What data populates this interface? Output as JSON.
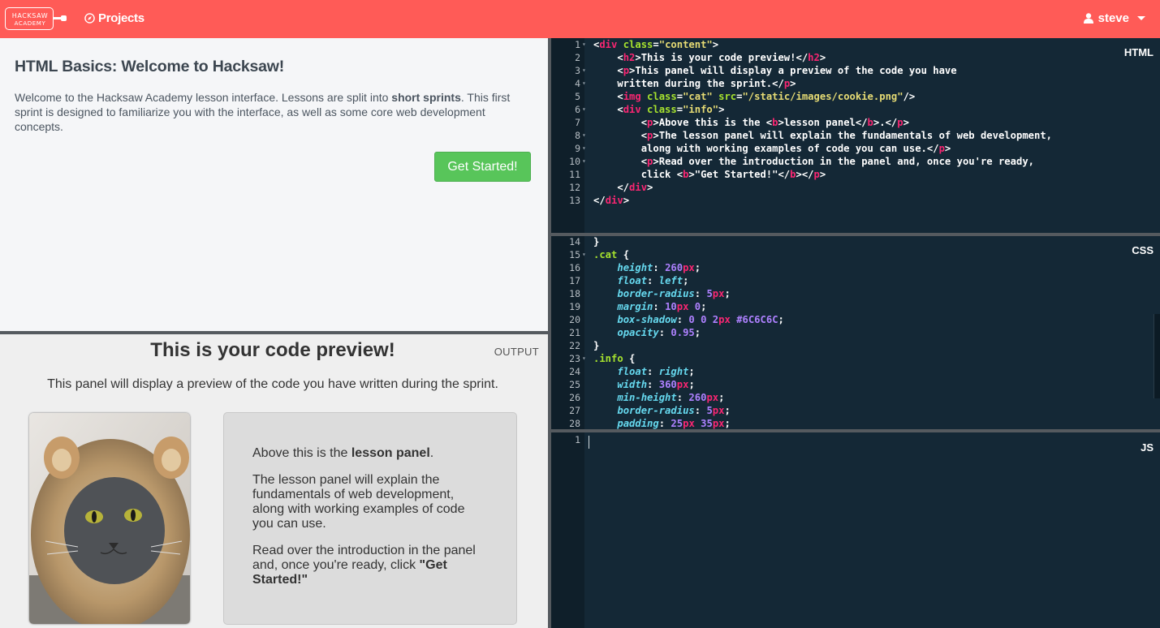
{
  "header": {
    "logo_line1": "HACKSAW",
    "logo_line2": "ACADEMY",
    "projects_label": "Projects",
    "user_name": "steve"
  },
  "lesson": {
    "title": "HTML Basics: Welcome to Hacksaw!",
    "intro_before": "Welcome to the Hacksaw Academy lesson interface. Lessons are split into ",
    "intro_bold": "short sprints",
    "intro_after": ". This first sprint is designed to familiarize you with the interface, as well as some core web development concepts.",
    "start_button": "Get Started!"
  },
  "output": {
    "label": "OUTPUT",
    "heading": "This is your code preview!",
    "paragraph": "This panel will display a preview of the code you have written during the sprint.",
    "info_p1_before": "Above this is the ",
    "info_p1_bold": "lesson panel",
    "info_p1_after": ".",
    "info_p2": "The lesson panel will explain the fundamentals of web development, along with working examples of code you can use.",
    "info_p3_before": "Read over the introduction in the panel and, once you're ready, click ",
    "info_p3_bold": "\"Get Started!\""
  },
  "editors": {
    "html_label": "HTML",
    "css_label": "CSS",
    "js_label": "JS"
  },
  "html_code": [
    {
      "n": "1",
      "fold": true,
      "segs": [
        [
          "p",
          "<"
        ],
        [
          "tag",
          "div"
        ],
        [
          "p",
          " "
        ],
        [
          "attr",
          "class"
        ],
        [
          "p",
          "="
        ],
        [
          "str",
          "\"content\""
        ],
        [
          "p",
          ">"
        ]
      ]
    },
    {
      "n": "2",
      "fold": false,
      "segs": [
        [
          "p",
          "    <"
        ],
        [
          "tag",
          "h2"
        ],
        [
          "p",
          ">This is your code preview!</"
        ],
        [
          "tag",
          "h2"
        ],
        [
          "p",
          ">"
        ]
      ]
    },
    {
      "n": "3",
      "fold": true,
      "segs": [
        [
          "p",
          "    <"
        ],
        [
          "tag",
          "p"
        ],
        [
          "p",
          ">This panel will display a preview of the code you have"
        ]
      ]
    },
    {
      "n": "4",
      "fold": true,
      "segs": [
        [
          "p",
          "    written during the sprint.</"
        ],
        [
          "tag",
          "p"
        ],
        [
          "p",
          ">"
        ]
      ]
    },
    {
      "n": "5",
      "fold": false,
      "segs": [
        [
          "p",
          "    <"
        ],
        [
          "tag",
          "img"
        ],
        [
          "p",
          " "
        ],
        [
          "attr",
          "class"
        ],
        [
          "p",
          "="
        ],
        [
          "str",
          "\"cat\""
        ],
        [
          "p",
          " "
        ],
        [
          "attr",
          "src"
        ],
        [
          "p",
          "="
        ],
        [
          "str",
          "\"/static/images/cookie.png\""
        ],
        [
          "p",
          "/>"
        ]
      ]
    },
    {
      "n": "6",
      "fold": true,
      "segs": [
        [
          "p",
          "    <"
        ],
        [
          "tag",
          "div"
        ],
        [
          "p",
          " "
        ],
        [
          "attr",
          "class"
        ],
        [
          "p",
          "="
        ],
        [
          "str",
          "\"info\""
        ],
        [
          "p",
          ">"
        ]
      ]
    },
    {
      "n": "7",
      "fold": false,
      "segs": [
        [
          "p",
          "        <"
        ],
        [
          "tag",
          "p"
        ],
        [
          "p",
          ">Above this is the <"
        ],
        [
          "tag",
          "b"
        ],
        [
          "p",
          ">lesson panel</"
        ],
        [
          "tag",
          "b"
        ],
        [
          "p",
          ">.</"
        ],
        [
          "tag",
          "p"
        ],
        [
          "p",
          ">"
        ]
      ]
    },
    {
      "n": "8",
      "fold": true,
      "segs": [
        [
          "p",
          "        <"
        ],
        [
          "tag",
          "p"
        ],
        [
          "p",
          ">The lesson panel will explain the fundamentals of web development,"
        ]
      ]
    },
    {
      "n": "9",
      "fold": true,
      "segs": [
        [
          "p",
          "        along with working examples of code you can use.</"
        ],
        [
          "tag",
          "p"
        ],
        [
          "p",
          ">"
        ]
      ]
    },
    {
      "n": "10",
      "fold": true,
      "segs": [
        [
          "p",
          "        <"
        ],
        [
          "tag",
          "p"
        ],
        [
          "p",
          ">Read over the introduction in the panel and, once you're ready,"
        ]
      ]
    },
    {
      "n": "11",
      "fold": false,
      "segs": [
        [
          "p",
          "        click <"
        ],
        [
          "tag",
          "b"
        ],
        [
          "p",
          ">\"Get Started!\"</"
        ],
        [
          "tag",
          "b"
        ],
        [
          "p",
          "></"
        ],
        [
          "tag",
          "p"
        ],
        [
          "p",
          ">"
        ]
      ]
    },
    {
      "n": "12",
      "fold": false,
      "segs": [
        [
          "p",
          "    </"
        ],
        [
          "tag",
          "div"
        ],
        [
          "p",
          ">"
        ]
      ]
    },
    {
      "n": "13",
      "fold": false,
      "segs": [
        [
          "p",
          "</"
        ],
        [
          "tag",
          "div"
        ],
        [
          "p",
          ">"
        ]
      ]
    }
  ],
  "css_code": [
    {
      "n": "14",
      "fold": false,
      "segs": [
        [
          "p",
          "}"
        ]
      ]
    },
    {
      "n": "15",
      "fold": true,
      "segs": [
        [
          "sel",
          ".cat"
        ],
        [
          "p",
          " {"
        ]
      ]
    },
    {
      "n": "16",
      "fold": false,
      "segs": [
        [
          "p",
          "    "
        ],
        [
          "prop",
          "height"
        ],
        [
          "p",
          ": "
        ],
        [
          "num",
          "260"
        ],
        [
          "unit",
          "px"
        ],
        [
          "p",
          ";"
        ]
      ]
    },
    {
      "n": "17",
      "fold": false,
      "segs": [
        [
          "p",
          "    "
        ],
        [
          "prop",
          "float"
        ],
        [
          "p",
          ": "
        ],
        [
          "prop",
          "left"
        ],
        [
          "p",
          ";"
        ]
      ]
    },
    {
      "n": "18",
      "fold": false,
      "segs": [
        [
          "p",
          "    "
        ],
        [
          "prop",
          "border-radius"
        ],
        [
          "p",
          ": "
        ],
        [
          "num",
          "5"
        ],
        [
          "unit",
          "px"
        ],
        [
          "p",
          ";"
        ]
      ]
    },
    {
      "n": "19",
      "fold": false,
      "segs": [
        [
          "p",
          "    "
        ],
        [
          "prop",
          "margin"
        ],
        [
          "p",
          ": "
        ],
        [
          "num",
          "10"
        ],
        [
          "unit",
          "px"
        ],
        [
          "p",
          " "
        ],
        [
          "num",
          "0"
        ],
        [
          "p",
          ";"
        ]
      ]
    },
    {
      "n": "20",
      "fold": false,
      "segs": [
        [
          "p",
          "    "
        ],
        [
          "prop",
          "box-shadow"
        ],
        [
          "p",
          ": "
        ],
        [
          "num",
          "0"
        ],
        [
          "p",
          " "
        ],
        [
          "num",
          "0"
        ],
        [
          "p",
          " "
        ],
        [
          "num",
          "2"
        ],
        [
          "unit",
          "px"
        ],
        [
          "p",
          " "
        ],
        [
          "num",
          "#6C6C6C"
        ],
        [
          "p",
          ";"
        ]
      ]
    },
    {
      "n": "21",
      "fold": false,
      "segs": [
        [
          "p",
          "    "
        ],
        [
          "prop",
          "opacity"
        ],
        [
          "p",
          ": "
        ],
        [
          "num",
          "0.95"
        ],
        [
          "p",
          ";"
        ]
      ]
    },
    {
      "n": "22",
      "fold": false,
      "segs": [
        [
          "p",
          "}"
        ]
      ]
    },
    {
      "n": "23",
      "fold": true,
      "segs": [
        [
          "sel",
          ".info"
        ],
        [
          "p",
          " {"
        ]
      ]
    },
    {
      "n": "24",
      "fold": false,
      "segs": [
        [
          "p",
          "    "
        ],
        [
          "prop",
          "float"
        ],
        [
          "p",
          ": "
        ],
        [
          "prop",
          "right"
        ],
        [
          "p",
          ";"
        ]
      ]
    },
    {
      "n": "25",
      "fold": false,
      "segs": [
        [
          "p",
          "    "
        ],
        [
          "prop",
          "width"
        ],
        [
          "p",
          ": "
        ],
        [
          "num",
          "360"
        ],
        [
          "unit",
          "px"
        ],
        [
          "p",
          ";"
        ]
      ]
    },
    {
      "n": "26",
      "fold": false,
      "segs": [
        [
          "p",
          "    "
        ],
        [
          "prop",
          "min-height"
        ],
        [
          "p",
          ": "
        ],
        [
          "num",
          "260"
        ],
        [
          "unit",
          "px"
        ],
        [
          "p",
          ";"
        ]
      ]
    },
    {
      "n": "27",
      "fold": false,
      "segs": [
        [
          "p",
          "    "
        ],
        [
          "prop",
          "border-radius"
        ],
        [
          "p",
          ": "
        ],
        [
          "num",
          "5"
        ],
        [
          "unit",
          "px"
        ],
        [
          "p",
          ";"
        ]
      ]
    },
    {
      "n": "28",
      "fold": false,
      "segs": [
        [
          "p",
          "    "
        ],
        [
          "prop",
          "padding"
        ],
        [
          "p",
          ": "
        ],
        [
          "num",
          "25"
        ],
        [
          "unit",
          "px"
        ],
        [
          "p",
          " "
        ],
        [
          "num",
          "35"
        ],
        [
          "unit",
          "px"
        ],
        [
          "p",
          ";"
        ]
      ]
    }
  ],
  "js_code": [
    {
      "n": "1",
      "fold": false,
      "segs": []
    }
  ]
}
